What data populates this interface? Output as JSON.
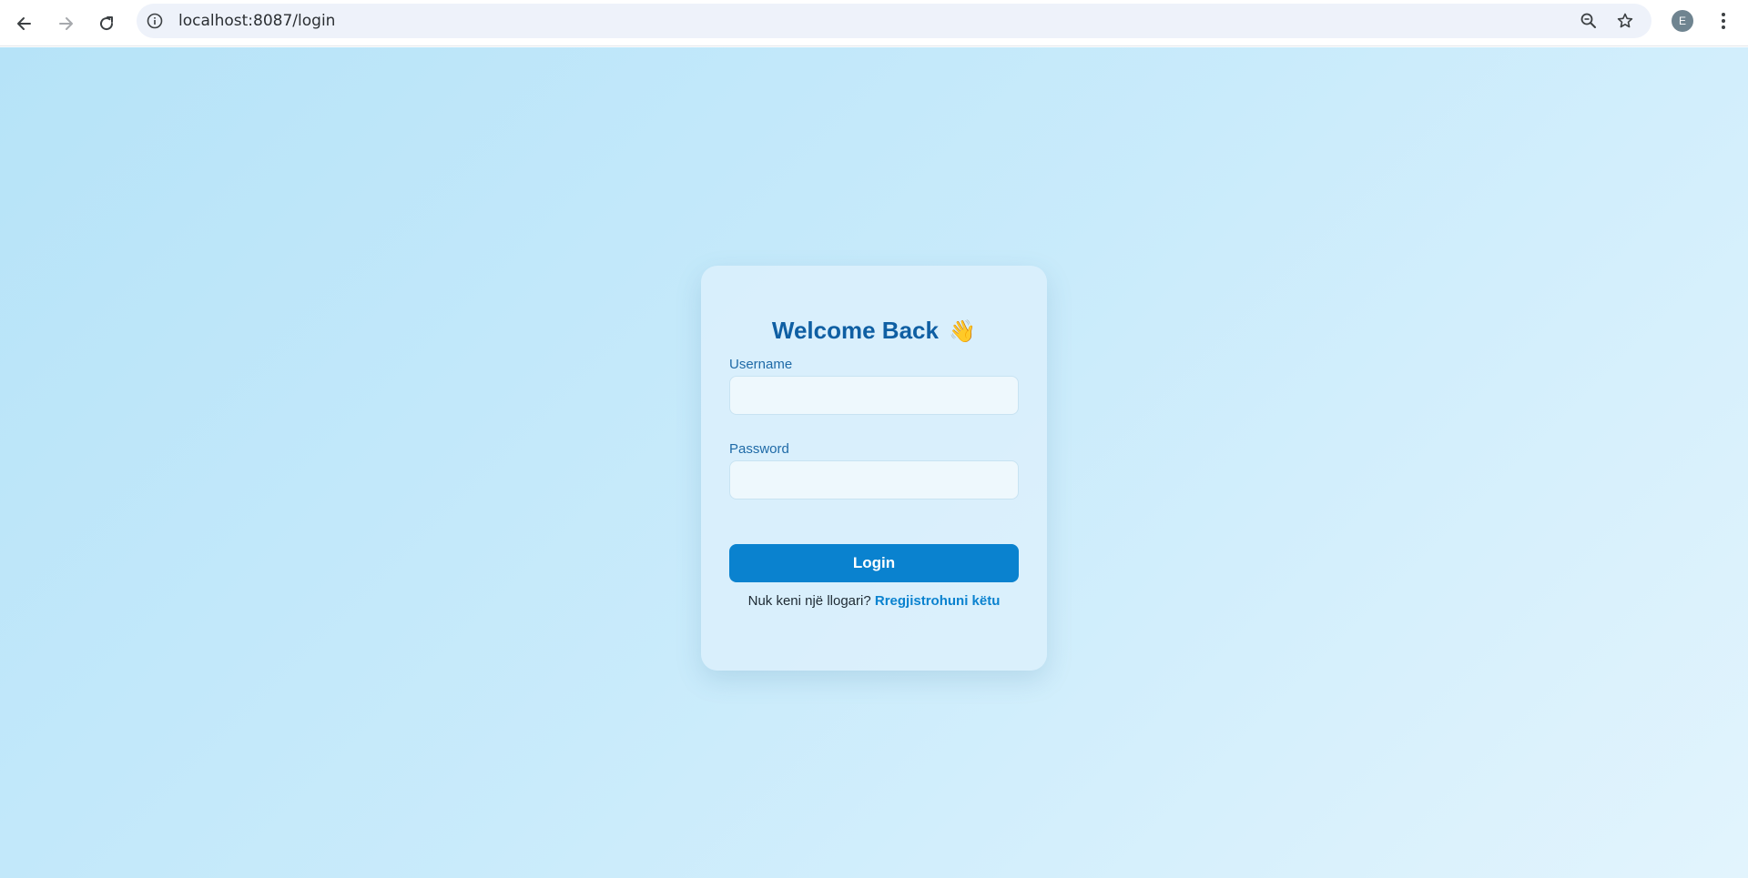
{
  "browser": {
    "url": "localhost:8087/login",
    "profile_initial": "E",
    "icons": {
      "back": "arrow-left-icon",
      "forward": "arrow-right-icon",
      "reload": "reload-icon",
      "site_info": "info-icon",
      "zoom": "zoom-icon",
      "bookmark": "star-icon",
      "menu": "kebab-menu-icon"
    }
  },
  "login": {
    "title": "Welcome Back",
    "title_emoji": "👋",
    "username_label": "Username",
    "username_value": "",
    "password_label": "Password",
    "password_value": "",
    "submit_label": "Login",
    "register_prompt": "Nuk keni një llogari?",
    "register_link": "Rregjistrohuni këtu"
  },
  "colors": {
    "primary": "#0a82cf",
    "title": "#0f5fa3",
    "background_start": "#b6e3f8",
    "background_end": "#e2f4fd"
  }
}
